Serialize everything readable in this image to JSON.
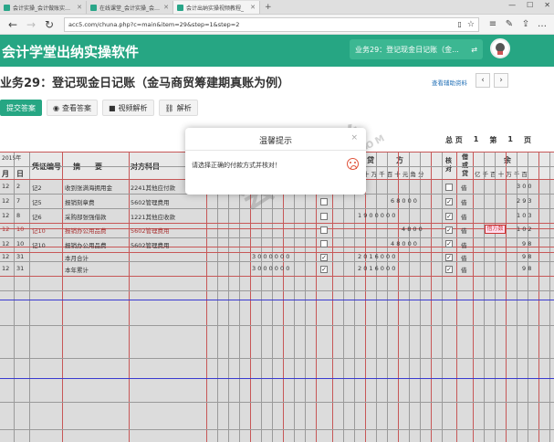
{
  "browser": {
    "tabs": [
      {
        "label": "会计实操_会计做账实操_会计"
      },
      {
        "label": "在线课堂_会计实操_会计学堂"
      },
      {
        "label": "会计出纳实操视频教程_"
      }
    ],
    "url": "acc5.com/chuna.php?c=main&item=29&step=1&step=2"
  },
  "app": {
    "title": "会计学堂出纳实操软件",
    "current_task": "业务29：登记现金日记账（金..."
  },
  "page": {
    "title": "业务29：登记现金日记账（金马商贸筹建期真账为例）",
    "help_link": "查看辅助资料",
    "prev": "‹",
    "next": "›"
  },
  "toolbar": {
    "submit": "提交答案",
    "view_answer": "查看答案",
    "video": "视频解析",
    "analysis": "解析"
  },
  "pageinfo": {
    "total_label": "总 页",
    "total": "1",
    "nth_label": "第",
    "nth": "1",
    "page_label": "页"
  },
  "ledger": {
    "year": "2015年",
    "h_month": "月",
    "h_day": "日",
    "h_voucher": "凭证编号",
    "h_summary": "摘　　要",
    "h_account": "对方科目",
    "h_credit": "贷　　　方",
    "h_check": "核对",
    "h_dir": "借或贷",
    "h_balance": "余",
    "digits_label": "十 万 千 百 十 元 角 分",
    "bal_digits_label": "亿 千 百 十 万 千 百",
    "rows": [
      {
        "m": "12",
        "d": "2",
        "v": "记2",
        "summary": "收到张满海拥用金",
        "acct": "2241其他应付款",
        "dir": "借",
        "credit": "",
        "bal": "3 0 0"
      },
      {
        "m": "12",
        "d": "7",
        "v": "记5",
        "summary": "报销刻章费",
        "acct": "5602管理费用",
        "dir": "借",
        "credit": "6 8 0 0 0",
        "bal": "2 9 3"
      },
      {
        "m": "12",
        "d": "8",
        "v": "记6",
        "summary": "采购部张强借款",
        "acct": "1221其他应收款",
        "dir": "借",
        "credit": "1 9 0 0 0 0 0",
        "bal": "1 0 3"
      },
      {
        "m": "12",
        "d": "10",
        "v": "记10",
        "summary": "报销办公用品费",
        "acct": "5602管理费用",
        "dir": "借",
        "credit": "4 8 0 0",
        "bal": "1 0 2"
      },
      {
        "m": "12",
        "d": "10",
        "v": "记10",
        "summary": "报销办公用品费",
        "acct": "5602管理费用",
        "dir": "借",
        "credit": "4 8 0 0 0",
        "bal": "9 8"
      },
      {
        "m": "12",
        "d": "31",
        "v": "",
        "summary": "本月合计",
        "acct": "",
        "dir": "借",
        "debit": "3 0 0 0 0 0 0",
        "credit": "2 0 1 6 0 0 0",
        "bal": "9 8"
      },
      {
        "m": "12",
        "d": "31",
        "v": "",
        "summary": "本年累计",
        "acct": "",
        "dir": "借",
        "debit": "3 0 0 0 0 0 0",
        "credit": "2 0 1 6 0 0 0",
        "bal": "9 8"
      }
    ],
    "bubble": "借方数"
  },
  "watermark": {
    "main": "会计学堂",
    "sub": "WWW.ACC5.COM"
  },
  "modal": {
    "title": "温馨提示",
    "close": "×",
    "message": "请选择正确的付款方式并核对！"
  }
}
